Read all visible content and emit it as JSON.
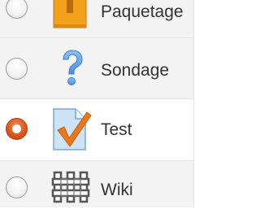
{
  "activities": [
    {
      "label": "Paquetage",
      "icon": "package-icon",
      "selected": false
    },
    {
      "label": "Sondage",
      "icon": "question-mark-icon",
      "selected": false
    },
    {
      "label": "Test",
      "icon": "quiz-checkmark-icon",
      "selected": true
    },
    {
      "label": "Wiki",
      "icon": "wiki-icon",
      "selected": false
    }
  ],
  "colors": {
    "radio_selected": "#d9551b",
    "row_alt_bg": "#f3f3f3",
    "package_orange": "#f2a21a",
    "question_blue": "#6aa9e9",
    "check_orange": "#e8781c"
  }
}
